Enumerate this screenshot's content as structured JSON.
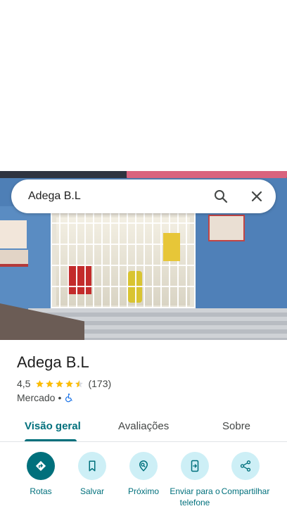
{
  "search": {
    "query": "Adega B.L"
  },
  "place": {
    "name": "Adega B.L",
    "rating": "4,5",
    "stars": 4.5,
    "review_count": "(173)",
    "category": "Mercado",
    "separator": "•"
  },
  "tabs": [
    {
      "label": "Visão geral",
      "active": true
    },
    {
      "label": "Avaliações",
      "active": false
    },
    {
      "label": "Sobre",
      "active": false
    }
  ],
  "actions": [
    {
      "label": "Rotas",
      "icon": "directions-icon"
    },
    {
      "label": "Salvar",
      "icon": "bookmark-icon"
    },
    {
      "label": "Próximo",
      "icon": "nearby-icon"
    },
    {
      "label": "Enviar para o telefone",
      "icon": "send-to-phone-icon"
    },
    {
      "label": "Compartilhar",
      "icon": "share-icon"
    }
  ],
  "colors": {
    "accent": "#00707c",
    "action_bg": "#cdeff6",
    "star": "#fbbc04"
  }
}
